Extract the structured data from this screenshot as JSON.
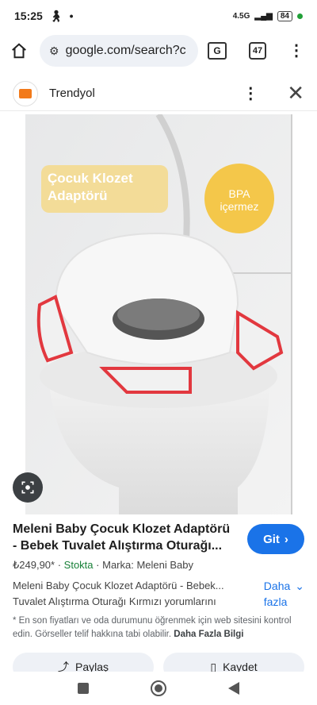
{
  "status": {
    "time": "15:25",
    "network": "4.5G",
    "battery": "84"
  },
  "browser": {
    "url": "google.com/search?c",
    "tab_count": "47",
    "translate_label": "G"
  },
  "source": {
    "name": "Trendyol"
  },
  "image": {
    "badge_title": "Çocuk Klozet Adaptörü",
    "bpa_line1": "BPA",
    "bpa_line2": "içermez"
  },
  "result": {
    "title": "Meleni Baby Çocuk Klozet Adaptörü - Bebek Tuvalet Alıştırma Oturağı...",
    "go_label": "Git",
    "price": "₺249,90*",
    "stock": "Stokta",
    "brand": "Marka: Meleni Baby",
    "description": "Meleni Baby Çocuk Klozet Adaptörü - Bebek... Tuvalet Alıştırma Oturağı Kırmızı yorumlarını",
    "more_line1": "Daha",
    "more_line2": "fazla",
    "note": "* En son fiyatları ve oda durumunu öğrenmek için web sitesini kontrol edin. Görseller telif hakkına tabi olabilir.",
    "note_link": "Daha Fazla Bilgi"
  },
  "actions": {
    "share": "Paylaş",
    "save": "Kaydet"
  },
  "colors": {
    "accent": "#1a73e8",
    "stock": "#188038",
    "brand_orange": "#f27a1a"
  }
}
